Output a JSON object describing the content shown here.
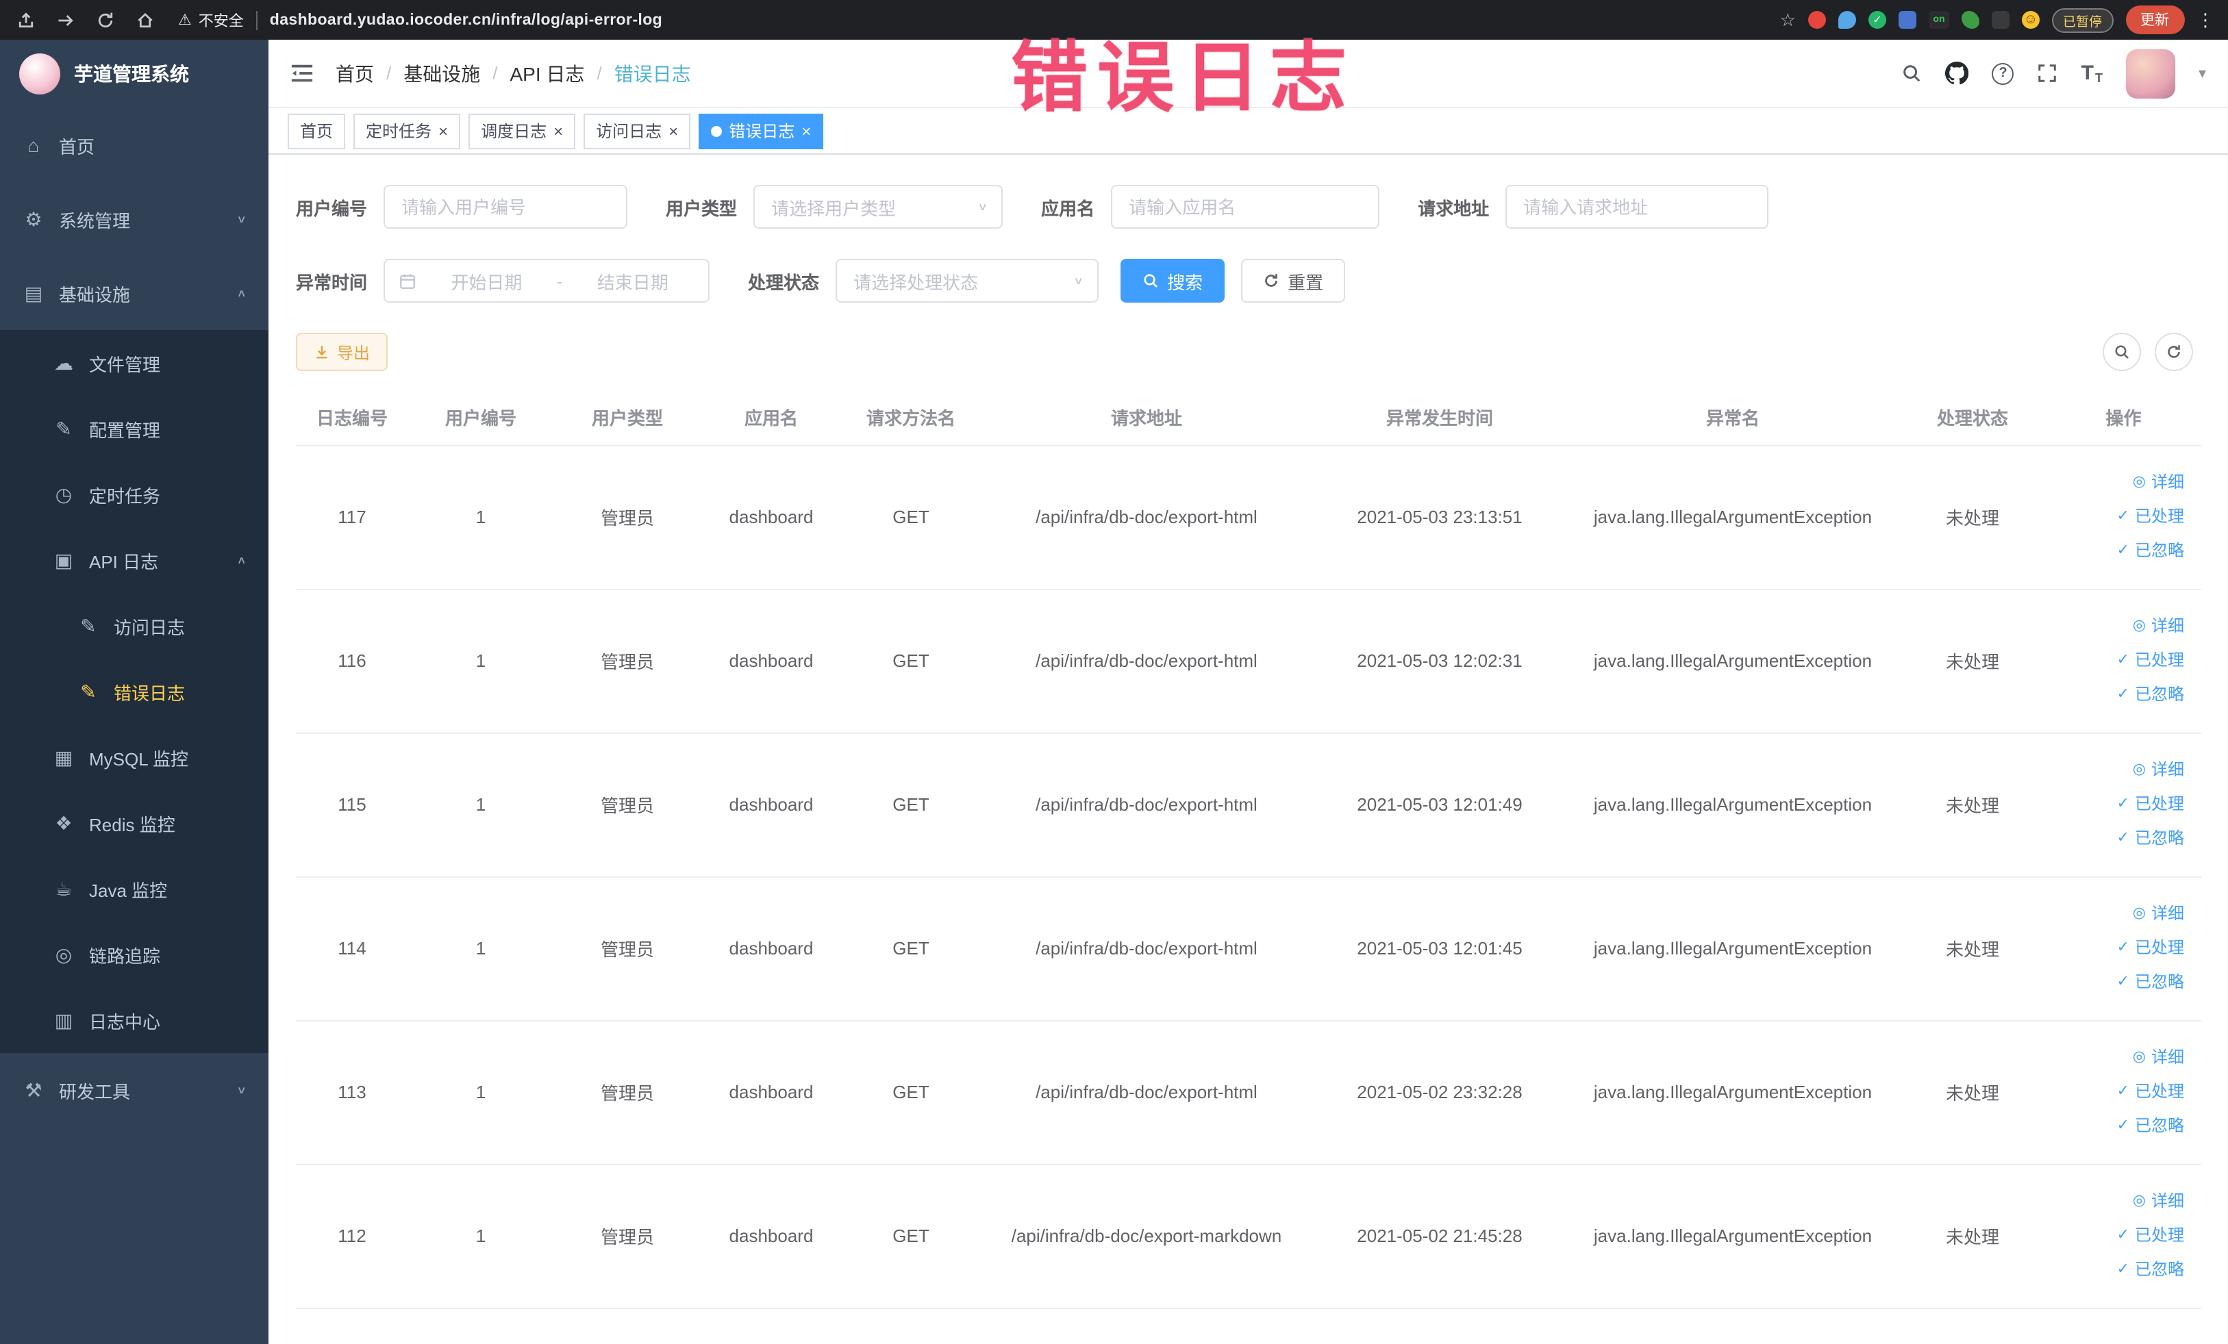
{
  "browser": {
    "security_label": "不安全",
    "url": "dashboard.yudao.iocoder.cn/infra/log/api-error-log",
    "paused_badge": "已暂停",
    "update_button": "更新",
    "extension_on_badge": "on"
  },
  "annotation": {
    "text": "错误日志",
    "color": "#ef4067"
  },
  "icons": {
    "warning": "⚠",
    "home": "⌂",
    "system": "⚙",
    "infra": "▤",
    "file": "☁",
    "config": "✎",
    "job": "◷",
    "api_log": "▣",
    "doc": "✎",
    "mysql": "▦",
    "redis": "❖",
    "java": "☕",
    "trace": "◎",
    "log_center": "▥",
    "dev": "⚒",
    "chevron_down": "∨",
    "chevron_up": "∧",
    "star": "☆",
    "more": "⋮",
    "caret_down": "▾",
    "eye": "◎",
    "check": "✓",
    "close": "×",
    "smiley": "☺",
    "question": "?"
  },
  "sidebar": {
    "logo_title": "芋道管理系统",
    "home": "首页",
    "system": "系统管理",
    "infra": "基础设施",
    "dev_tools": "研发工具",
    "infra_items": [
      "文件管理",
      "配置管理",
      "定时任务",
      "API 日志",
      "MySQL 监控",
      "Redis 监控",
      "Java 监控",
      "链路追踪",
      "日志中心"
    ],
    "api_log_items": [
      "访问日志",
      "错误日志"
    ]
  },
  "navbar": {
    "breadcrumbs": [
      "首页",
      "基础设施",
      "API 日志",
      "错误日志"
    ],
    "crumb_separator": "/"
  },
  "tabs": [
    {
      "label": "首页"
    },
    {
      "label": "定时任务"
    },
    {
      "label": "调度日志"
    },
    {
      "label": "访问日志"
    },
    {
      "label": "错误日志"
    }
  ],
  "filters": {
    "user_id_label": "用户编号",
    "user_id_placeholder": "请输入用户编号",
    "user_type_label": "用户类型",
    "user_type_placeholder": "请选择用户类型",
    "app_name_label": "应用名",
    "app_name_placeholder": "请输入应用名",
    "request_url_label": "请求地址",
    "request_url_placeholder": "请输入请求地址",
    "exception_time_label": "异常时间",
    "start_date_placeholder": "开始日期",
    "range_separator": "-",
    "end_date_placeholder": "结束日期",
    "process_status_label": "处理状态",
    "process_status_placeholder": "请选择处理状态",
    "search_button": "搜索",
    "reset_button": "重置"
  },
  "toolbar": {
    "export_button": "导出"
  },
  "table": {
    "columns": [
      "日志编号",
      "用户编号",
      "用户类型",
      "应用名",
      "请求方法名",
      "请求地址",
      "异常发生时间",
      "异常名",
      "处理状态",
      "操作"
    ],
    "actions": [
      "详细",
      "已处理",
      "已忽略"
    ],
    "rows": [
      {
        "log_id": "117",
        "user_id": "1",
        "user_type": "管理员",
        "app_name": "dashboard",
        "method": "GET",
        "url": "/api/infra/db-doc/export-html",
        "time": "2021-05-03 23:13:51",
        "exception": "java.lang.IllegalArgumentException",
        "status": "未处理"
      },
      {
        "log_id": "116",
        "user_id": "1",
        "user_type": "管理员",
        "app_name": "dashboard",
        "method": "GET",
        "url": "/api/infra/db-doc/export-html",
        "time": "2021-05-03 12:02:31",
        "exception": "java.lang.IllegalArgumentException",
        "status": "未处理"
      },
      {
        "log_id": "115",
        "user_id": "1",
        "user_type": "管理员",
        "app_name": "dashboard",
        "method": "GET",
        "url": "/api/infra/db-doc/export-html",
        "time": "2021-05-03 12:01:49",
        "exception": "java.lang.IllegalArgumentException",
        "status": "未处理"
      },
      {
        "log_id": "114",
        "user_id": "1",
        "user_type": "管理员",
        "app_name": "dashboard",
        "method": "GET",
        "url": "/api/infra/db-doc/export-html",
        "time": "2021-05-03 12:01:45",
        "exception": "java.lang.IllegalArgumentException",
        "status": "未处理"
      },
      {
        "log_id": "113",
        "user_id": "1",
        "user_type": "管理员",
        "app_name": "dashboard",
        "method": "GET",
        "url": "/api/infra/db-doc/export-html",
        "time": "2021-05-02 23:32:28",
        "exception": "java.lang.IllegalArgumentException",
        "status": "未处理"
      },
      {
        "log_id": "112",
        "user_id": "1",
        "user_type": "管理员",
        "app_name": "dashboard",
        "method": "GET",
        "url": "/api/infra/db-doc/export-markdown",
        "time": "2021-05-02 21:45:28",
        "exception": "java.lang.IllegalArgumentException",
        "status": "未处理"
      }
    ]
  }
}
